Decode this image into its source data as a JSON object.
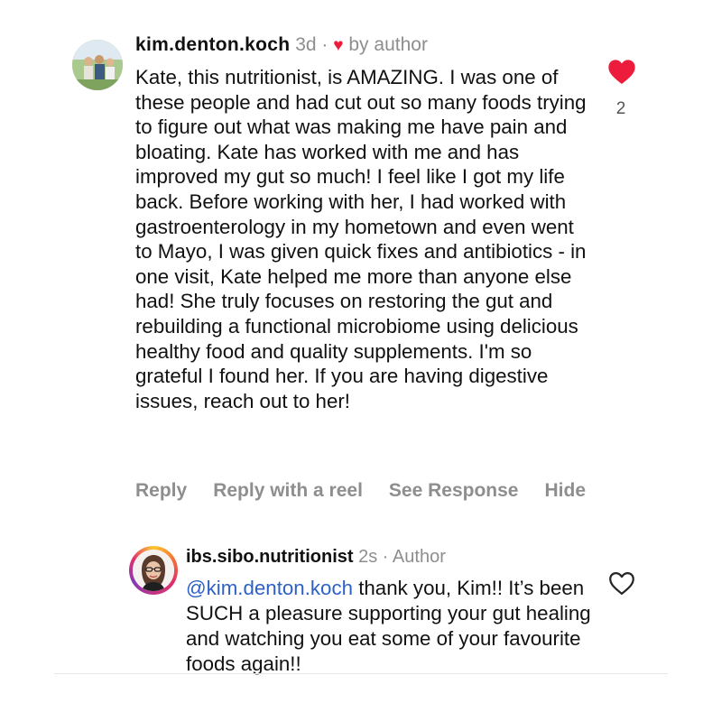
{
  "comment": {
    "username": "kim.denton.koch",
    "time": "3d",
    "separator": "·",
    "liked_by": "by author",
    "text": "Kate, this nutritionist, is AMAZING. I was one of these people and had cut out so many foods trying to figure out what was making me have pain and bloating. Kate has worked with me and has improved my gut so much! I feel like I got my life back. Before working with her, I had worked with gastroenterology in my hometown and even went to Mayo, I was given quick fixes and antibiotics - in one visit, Kate helped me more than anyone else had! She truly focuses on restoring the gut and rebuilding a functional microbiome using delicious healthy food and quality supplements. I'm so grateful I found her. If you are having digestive issues, reach out to her!",
    "like_count": "2",
    "like_icon": "heart-filled-icon",
    "like_color": "#ed1c3c"
  },
  "actions": {
    "reply": "Reply",
    "reply_reel": "Reply with a reel",
    "see_response": "See Response",
    "hide": "Hide"
  },
  "reply": {
    "username": "ibs.sibo.nutritionist",
    "time": "2s",
    "separator": "·",
    "badge": "Author",
    "mention": "@kim.denton.koch",
    "text": " thank you, Kim!! It’s been SUCH a pleasure supporting your gut healing and watching you eat some of your favourite foods again!!",
    "like_icon": "heart-outline-icon"
  },
  "colors": {
    "mention": "#2d61c6",
    "muted": "#8e8e8e"
  }
}
